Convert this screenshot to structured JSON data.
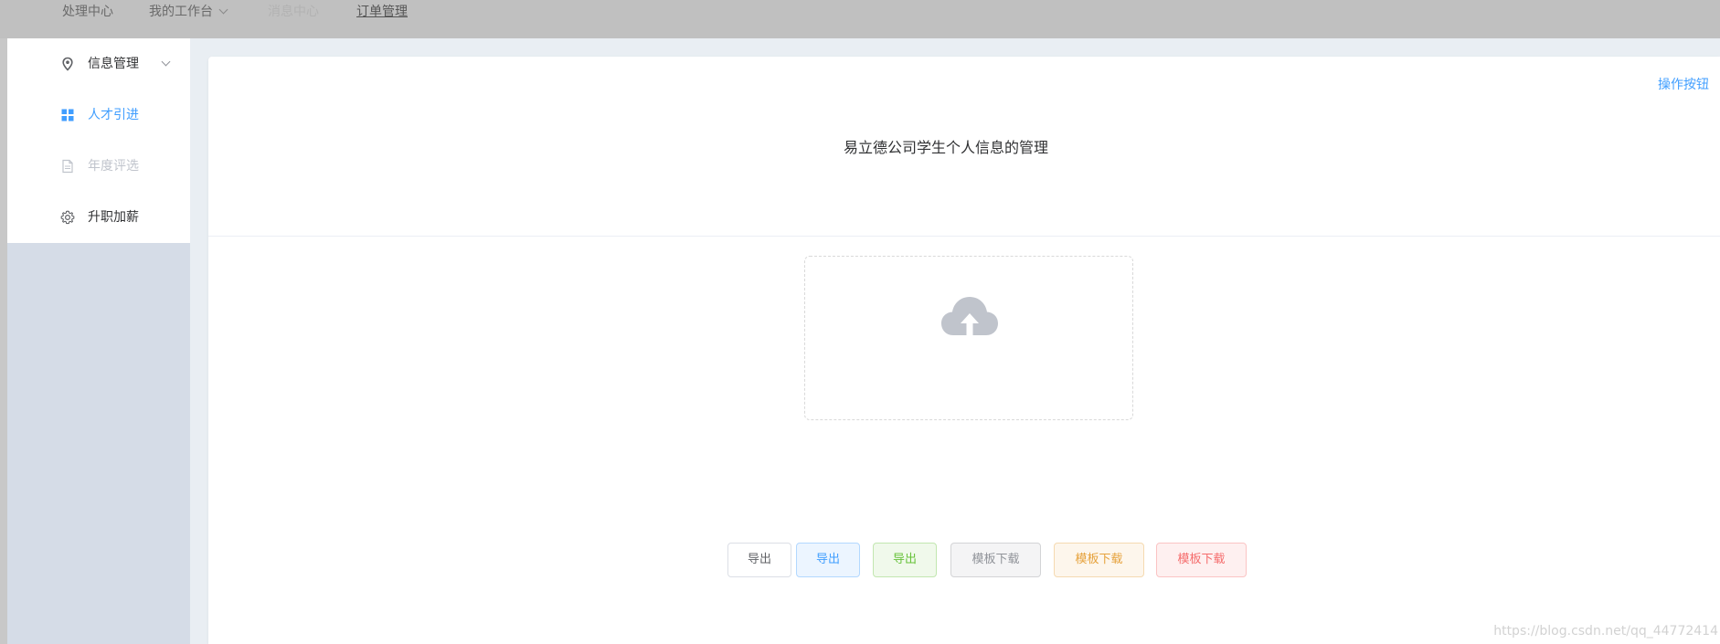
{
  "topnav": {
    "items": [
      {
        "label": "处理中心"
      },
      {
        "label": "我的工作台"
      },
      {
        "label": "消息中心"
      },
      {
        "label": "订单管理"
      }
    ]
  },
  "sidebar": {
    "items": [
      {
        "label": "信息管理",
        "icon": "location-icon"
      },
      {
        "label": "人才引进",
        "icon": "grid-icon"
      },
      {
        "label": "年度评选",
        "icon": "document-icon"
      },
      {
        "label": "升职加薪",
        "icon": "gear-icon"
      }
    ]
  },
  "card": {
    "op_button": "操作按钮",
    "title": "易立德公司学生个人信息的管理"
  },
  "upload": {
    "icon": "cloud-upload-icon"
  },
  "buttons": [
    {
      "label": "导出",
      "type": "default"
    },
    {
      "label": "导出",
      "type": "primary"
    },
    {
      "label": "导出",
      "type": "success"
    },
    {
      "label": "模板下载",
      "type": "info"
    },
    {
      "label": "模板下载",
      "type": "warning"
    },
    {
      "label": "模板下载",
      "type": "danger"
    }
  ],
  "watermark": "https://blog.csdn.net/qq_44772414",
  "colors": {
    "primary": "#409eff",
    "success": "#67c23a",
    "info": "#909399",
    "warning": "#e6a23c",
    "danger": "#f56c6c",
    "sidebar_bg": "#d5dce7",
    "topbar_bg": "#c0c0c0",
    "main_bg": "#e9eef3"
  }
}
